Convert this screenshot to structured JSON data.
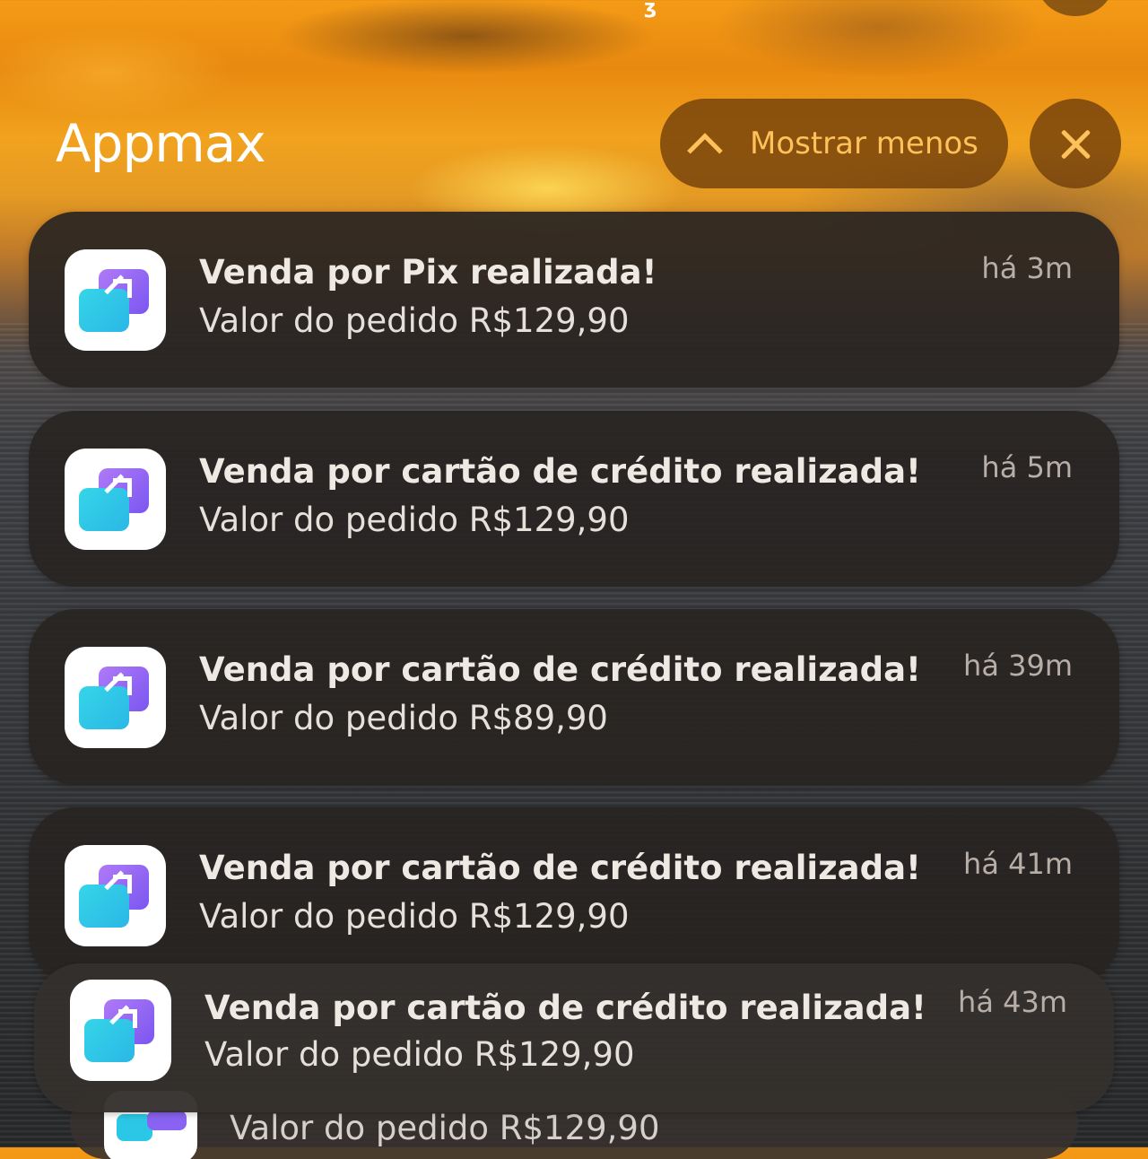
{
  "status_bar": {
    "indicator": "ʒ"
  },
  "header": {
    "app_name": "Appmax",
    "show_less_label": "Mostrar menos"
  },
  "notifications": [
    {
      "title": "Venda por Pix realizada!",
      "body": "Valor do pedido R$129,90",
      "time": "há 3m"
    },
    {
      "title": "Venda por cartão de crédito realizada!",
      "body": "Valor do pedido R$129,90",
      "time": "há 5m"
    },
    {
      "title": "Venda por cartão de crédito realizada!",
      "body": "Valor do pedido R$89,90",
      "time": "há 39m"
    },
    {
      "title": "Venda por cartão de crédito realizada!",
      "body": "Valor do pedido R$129,90",
      "time": "há 41m"
    },
    {
      "title": "Venda por cartão de crédito realizada!",
      "body": "Valor do pedido R$129,90",
      "time": "há 43m"
    }
  ],
  "stack_peek": {
    "body": "Valor do pedido R$129,90"
  },
  "icons": {
    "app_icon": "appmax-logo-icon",
    "show_less": "chevron-up-icon",
    "close": "close-icon"
  },
  "colors": {
    "accent": "#ffc15a",
    "pill_bg": "#6e3c0a",
    "card_bg": "#282422",
    "icon_purple": "#8a63f2",
    "icon_cyan": "#2bc7e6"
  }
}
